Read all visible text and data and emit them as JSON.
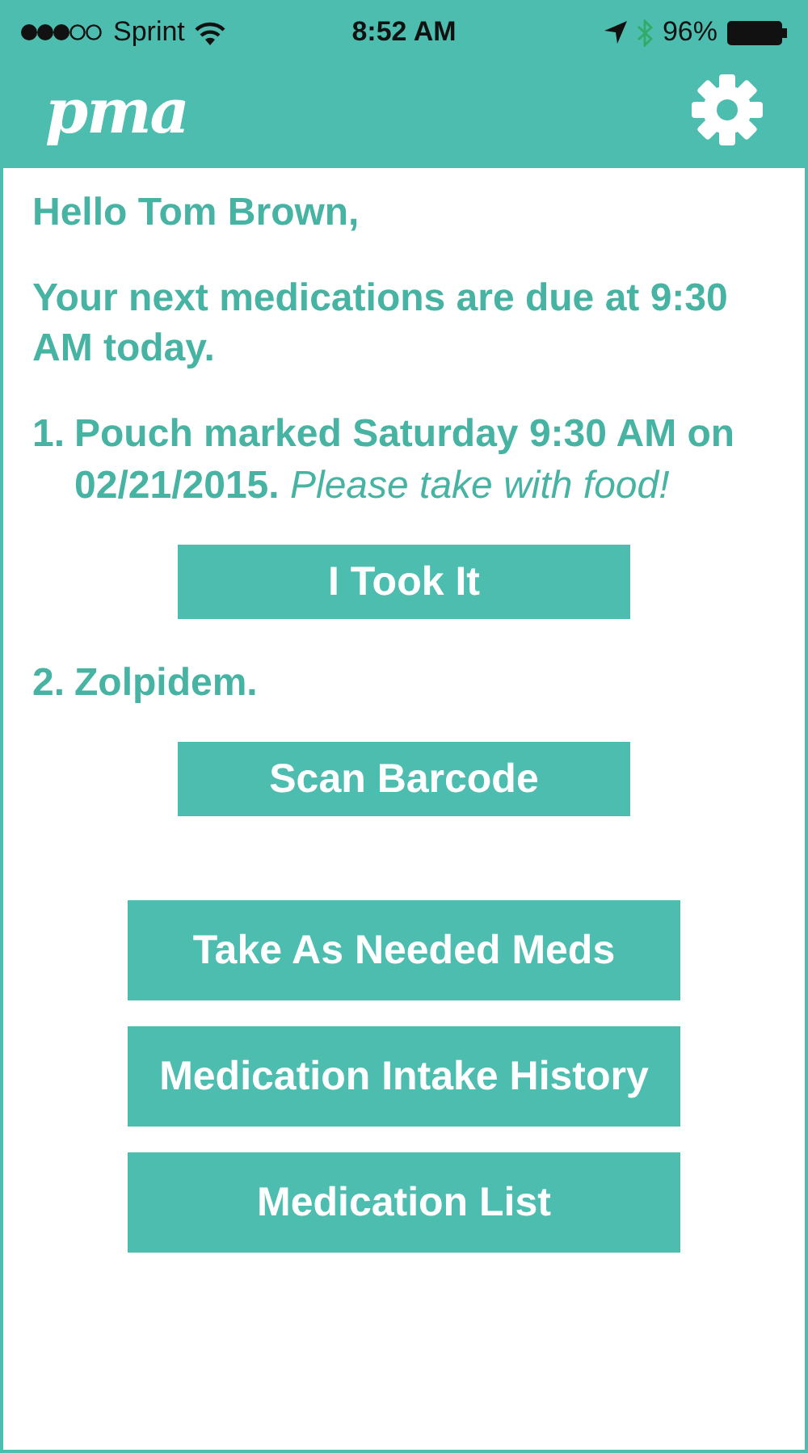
{
  "status_bar": {
    "carrier": "Sprint",
    "time": "8:52 AM",
    "battery": "96%"
  },
  "header": {
    "logo": "pma"
  },
  "greeting": "Hello Tom Brown,",
  "next_due": "Your next medications are due at 9:30 AM today.",
  "medications": [
    {
      "number": "1.",
      "text": "**Pouch marked Saturday 9:30 AM on 02/21/2015.** *Please take with food!*",
      "action": "I Took It"
    },
    {
      "number": "2.",
      "text": "**Zolpidem.**",
      "action": "Scan Barcode"
    }
  ],
  "menu_buttons": [
    "Take As Needed Meds",
    "Medication Intake History",
    "Medication List"
  ]
}
